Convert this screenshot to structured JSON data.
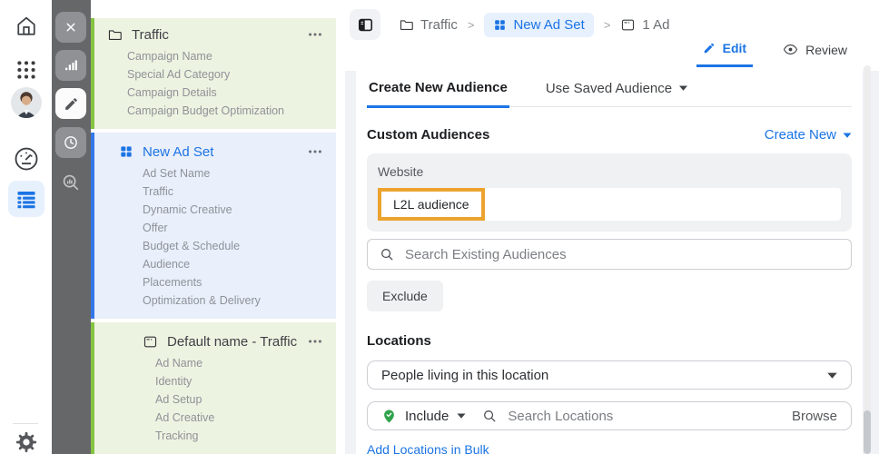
{
  "colors": {
    "accent_green": "#85c342",
    "accent_blue": "#3377e8",
    "link_blue": "#1b74e4",
    "highlight_orange": "#eca32e",
    "include_pin_green": "#31a24c"
  },
  "rail_icons": [
    "home-icon",
    "apps-grid-icon",
    "profile-avatar",
    "gauge-icon",
    "data-table-icon",
    "gear-icon"
  ],
  "toolbar_icons": [
    "close-icon",
    "bar-chart-icon",
    "pencil-icon",
    "clock-icon",
    "zoom-chart-icon"
  ],
  "tree": {
    "campaign": {
      "title": "Traffic",
      "icon": "folder-icon",
      "menu_icon": "ellipsis-icon",
      "items": [
        "Campaign Name",
        "Special Ad Category",
        "Campaign Details",
        "Campaign Budget Optimization"
      ]
    },
    "adset": {
      "title": "New Ad Set",
      "icon": "adset-grid-icon",
      "menu_icon": "ellipsis-icon",
      "items": [
        "Ad Set Name",
        "Traffic",
        "Dynamic Creative",
        "Offer",
        "Budget & Schedule",
        "Audience",
        "Placements",
        "Optimization & Delivery"
      ]
    },
    "ad": {
      "title": "Default name - Traffic",
      "icon": "ad-frame-icon",
      "menu_icon": "ellipsis-icon",
      "items": [
        "Ad Name",
        "Identity",
        "Ad Setup",
        "Ad Creative",
        "Tracking"
      ]
    }
  },
  "breadcrumb": {
    "campaign": "Traffic",
    "adset": "New Ad Set",
    "ad": "1 Ad",
    "separator": ">"
  },
  "view_tabs": {
    "edit": "Edit",
    "review": "Review"
  },
  "audience_tabs": {
    "create": "Create New Audience",
    "saved": "Use Saved Audience"
  },
  "custom_audiences": {
    "title": "Custom Audiences",
    "create_new": "Create New",
    "group_label": "Website",
    "selected_audience": "L2L audience",
    "search_placeholder": "Search Existing Audiences",
    "exclude": "Exclude"
  },
  "locations": {
    "title": "Locations",
    "mode": "People living in this location",
    "include": "Include",
    "search_placeholder": "Search Locations",
    "browse": "Browse",
    "bulk_link": "Add Locations in Bulk"
  }
}
